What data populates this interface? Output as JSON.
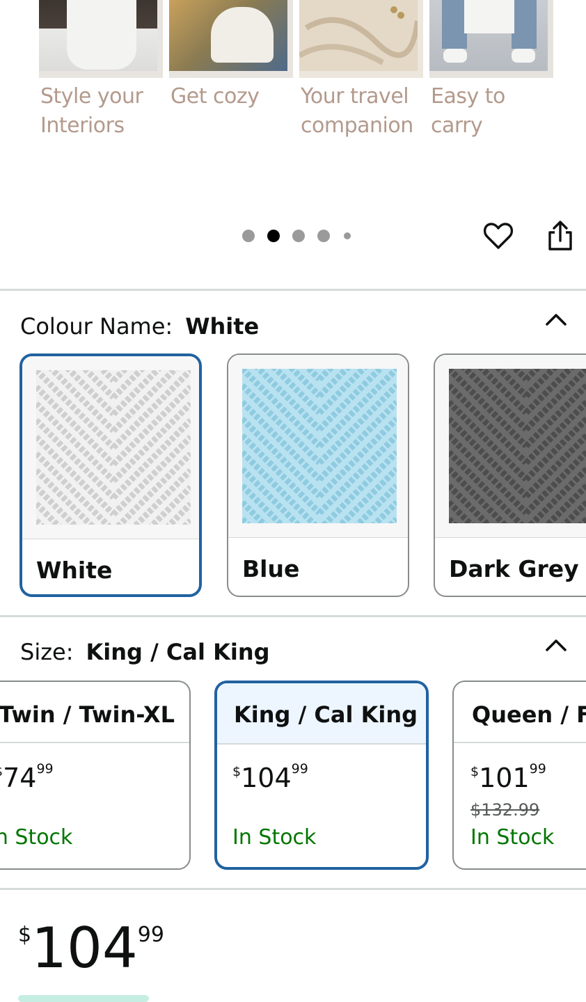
{
  "carousel": {
    "slides": [
      {
        "caption": "Style your Interiors",
        "icon": "throw-on-sofa-photo",
        "color": "#5a5048"
      },
      {
        "caption": "Get cozy",
        "icon": "person-wrapped-in-throw-photo",
        "color": "#8a7b52"
      },
      {
        "caption": "Your travel companion",
        "icon": "tote-bag-straps-photo",
        "color": "#e2d6c6"
      },
      {
        "caption": "Easy to carry",
        "icon": "carrying-tote-photo",
        "color": "#c8ccd0"
      }
    ],
    "dots": 5,
    "active_dot": 1,
    "favorite_icon": "heart-icon",
    "share_icon": "share-icon"
  },
  "colour": {
    "label": "Colour Name:",
    "selected": "White",
    "options": [
      {
        "name": "White",
        "color": "#f1f1f1",
        "stitch": "#cfcfcf"
      },
      {
        "name": "Blue",
        "color": "#b9e2f0",
        "stitch": "#8fcbe0"
      },
      {
        "name": "Dark Grey",
        "color": "#6b6b6b",
        "stitch": "#4d4d4d"
      }
    ],
    "collapse_icon": "chevron-up-icon"
  },
  "size": {
    "label": "Size:",
    "selected": "King / Cal King",
    "options": [
      {
        "name": "Twin / Twin-XL",
        "currency": "$",
        "whole": "74",
        "fraction": "99",
        "list_price": "",
        "availability": "In Stock"
      },
      {
        "name": "King / Cal King",
        "currency": "$",
        "whole": "104",
        "fraction": "99",
        "list_price": "",
        "availability": "In Stock"
      },
      {
        "name": "Queen / F",
        "currency": "$",
        "whole": "101",
        "fraction": "99",
        "list_price": "$132.99",
        "availability": "In Stock"
      }
    ],
    "collapse_icon": "chevron-up-icon"
  },
  "price": {
    "currency": "$",
    "whole": "104",
    "fraction": "99"
  },
  "colors": {
    "accent": "#2162a1",
    "in_stock": "#007600",
    "caption": "#b39a8c"
  }
}
